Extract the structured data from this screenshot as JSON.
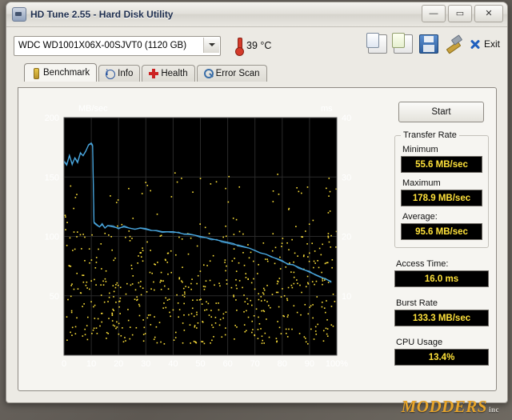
{
  "window": {
    "title": "HD Tune 2.55 - Hard Disk Utility",
    "icon": "hard-disk-icon",
    "buttons": {
      "minimize": "—",
      "maximize": "▭",
      "close": "✕"
    }
  },
  "toolbar": {
    "drive": "WDC WD1001X06X-00SJVT0 (1120 GB)",
    "temperature": "39 °C",
    "icons": [
      "copy-graph-icon",
      "copy-info-icon",
      "save-icon",
      "tools-icon"
    ],
    "exit_label": "Exit"
  },
  "tabs": [
    {
      "label": "Benchmark",
      "icon": "benchmark-icon",
      "active": true
    },
    {
      "label": "Info",
      "icon": "info-icon",
      "active": false
    },
    {
      "label": "Health",
      "icon": "health-icon",
      "active": false
    },
    {
      "label": "Error Scan",
      "icon": "error-scan-icon",
      "active": false
    }
  ],
  "sidebar": {
    "start_label": "Start",
    "transfer_rate": {
      "group_label": "Transfer Rate",
      "minimum_label": "Minimum",
      "minimum_value": "55.6 MB/sec",
      "maximum_label": "Maximum",
      "maximum_value": "178.9 MB/sec",
      "average_label": "Average:",
      "average_value": "95.6 MB/sec"
    },
    "access_time_label": "Access Time:",
    "access_time_value": "16.0 ms",
    "burst_rate_label": "Burst Rate",
    "burst_rate_value": "133.3 MB/sec",
    "cpu_usage_label": "CPU Usage",
    "cpu_usage_value": "13.4%"
  },
  "watermark": {
    "text": "MODDERS",
    "suffix": "inc"
  },
  "chart_data": {
    "type": "line",
    "title": "",
    "ylabel": "MB/sec",
    "ylabel_right": "ms",
    "xlabel": "%",
    "bg_color": "#000000",
    "line_color": "#4aa8e0",
    "dot_color": "#ffe23a",
    "grid": true,
    "xlim": [
      0,
      100
    ],
    "ylim": [
      0,
      200
    ],
    "ylim_right": [
      0,
      40
    ],
    "xticks": [
      0,
      10,
      20,
      30,
      40,
      50,
      60,
      70,
      80,
      90,
      100
    ],
    "xtick_labels": [
      "0",
      "10",
      "20",
      "30",
      "40",
      "50",
      "60",
      "70",
      "80",
      "90",
      "100%"
    ],
    "yticks": [
      50,
      100,
      150,
      200
    ],
    "ytick_labels": [
      "50",
      "100",
      "150",
      "200"
    ],
    "yticks_right": [
      10,
      20,
      30,
      40
    ],
    "ytick_labels_right": [
      "10",
      "20",
      "30",
      "40"
    ],
    "series": [
      {
        "name": "Transfer rate",
        "unit": "MB/sec",
        "x": [
          0,
          1,
          2,
          3,
          4,
          5,
          6,
          7,
          8,
          9,
          10,
          10.5,
          11,
          12,
          13,
          14,
          15,
          16,
          18,
          20,
          22,
          24,
          26,
          28,
          30,
          32,
          34,
          36,
          38,
          40,
          42,
          44,
          46,
          48,
          50,
          52,
          54,
          56,
          58,
          60,
          62,
          64,
          66,
          68,
          70,
          72,
          74,
          76,
          78,
          80,
          82,
          84,
          86,
          88,
          90,
          92,
          94,
          96,
          98,
          100
        ],
        "y": [
          163,
          160,
          168,
          161,
          166,
          162,
          170,
          168,
          172,
          177,
          178,
          176,
          112,
          110,
          108,
          110,
          107,
          109,
          108,
          107,
          108,
          107,
          106,
          107,
          106,
          105,
          105,
          104,
          104,
          104,
          103,
          102,
          102,
          101,
          100,
          99,
          98,
          97,
          96,
          95,
          94,
          92,
          91,
          90,
          88,
          86,
          85,
          83,
          81,
          79,
          77,
          76,
          74,
          72,
          70,
          68,
          66,
          64,
          62
        ]
      },
      {
        "name": "Access time samples",
        "unit": "ms",
        "description": "yellow scatter dots, access latency measurements spread 0-100% across 2-31 ms, dense cluster below 16 ms"
      }
    ]
  }
}
